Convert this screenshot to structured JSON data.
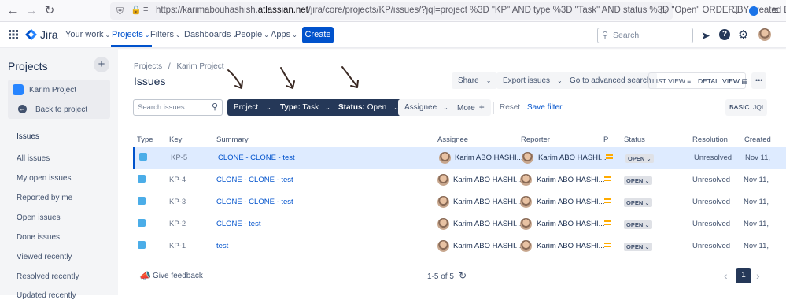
{
  "browser": {
    "url_prefix": "https://karimabouhashish.",
    "url_host": "atlassian.net",
    "url_rest": "/jira/core/projects/KP/issues/?jql=project %3D \"KP\" AND type %3D \"Task\" AND status %3D \"Open\" ORDER BY created DESC"
  },
  "topnav": {
    "brand": "Jira",
    "items": [
      {
        "label": "Your work"
      },
      {
        "label": "Projects"
      },
      {
        "label": "Filters"
      },
      {
        "label": "Dashboards"
      },
      {
        "label": "People"
      },
      {
        "label": "Apps"
      }
    ],
    "create_label": "Create",
    "search_placeholder": "Search"
  },
  "sidebar": {
    "title": "Projects",
    "project_name": "Karim Project",
    "back_label": "Back to project",
    "section_label": "Issues",
    "links": [
      "All issues",
      "My open issues",
      "Reported by me",
      "Open issues",
      "Done issues",
      "Viewed recently",
      "Resolved recently",
      "Updated recently"
    ]
  },
  "breadcrumb": {
    "root": "Projects",
    "sep": "/",
    "project": "Karim Project"
  },
  "page_title": "Issues",
  "toolbar": {
    "share": "Share",
    "export": "Export issues",
    "advanced": "Go to advanced search",
    "list_view": "LIST VIEW",
    "detail_view": "DETAIL VIEW",
    "more_actions": "•••"
  },
  "filters": {
    "search_placeholder": "Search issues",
    "project": "Project",
    "type_key": "Type:",
    "type_value": "Task",
    "status_key": "Status:",
    "status_value": "Open",
    "assignee": "Assignee",
    "more": "More",
    "reset": "Reset",
    "save": "Save filter",
    "basic": "BASIC",
    "jql": "JQL"
  },
  "table": {
    "headers": {
      "type": "Type",
      "key": "Key",
      "summary": "Summary",
      "assignee": "Assignee",
      "reporter": "Reporter",
      "priority": "P",
      "status": "Status",
      "resolution": "Resolution",
      "created": "Created"
    },
    "rows": [
      {
        "key": "KP-5",
        "summary": "CLONE - CLONE - test",
        "assignee": "Karim ABO HASHI...",
        "reporter": "Karim ABO HASHI...",
        "status": "OPEN",
        "resolution": "Unresolved",
        "created": "Nov 11,"
      },
      {
        "key": "KP-4",
        "summary": "CLONE - CLONE - test",
        "assignee": "Karim ABO HASHI...",
        "reporter": "Karim ABO HASHI...",
        "status": "OPEN",
        "resolution": "Unresolved",
        "created": "Nov 11,"
      },
      {
        "key": "KP-3",
        "summary": "CLONE - CLONE - test",
        "assignee": "Karim ABO HASHI...",
        "reporter": "Karim ABO HASHI...",
        "status": "OPEN",
        "resolution": "Unresolved",
        "created": "Nov 11,"
      },
      {
        "key": "KP-2",
        "summary": "CLONE - test",
        "assignee": "Karim ABO HASHI...",
        "reporter": "Karim ABO HASHI...",
        "status": "OPEN",
        "resolution": "Unresolved",
        "created": "Nov 11,"
      },
      {
        "key": "KP-1",
        "summary": "test",
        "assignee": "Karim ABO HASHI...",
        "reporter": "Karim ABO HASHI...",
        "status": "OPEN",
        "resolution": "Unresolved",
        "created": "Nov 11,"
      }
    ]
  },
  "footer": {
    "feedback": "Give feedback",
    "count": "1-5 of 5",
    "page": "1"
  },
  "colors": {
    "accent": "#0052cc",
    "dark_button": "#253858",
    "selected_row": "#deebff",
    "priority_medium": "#ffab00"
  }
}
